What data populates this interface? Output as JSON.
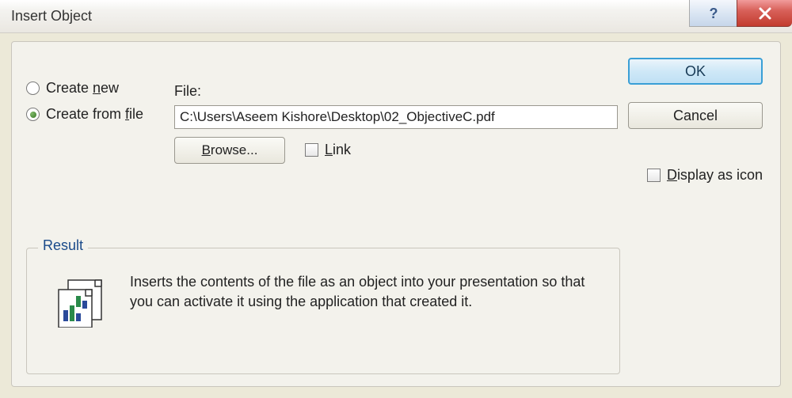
{
  "title": "Insert Object",
  "radios": {
    "create_new": "Create new",
    "create_from_file": "Create from file",
    "selected": "create_from_file"
  },
  "file_label": "File:",
  "file_path": "C:\\Users\\Aseem Kishore\\Desktop\\02_ObjectiveC.pdf",
  "browse": "Browse...",
  "link": "Link",
  "display_as_icon": "Display as icon",
  "ok": "OK",
  "cancel": "Cancel",
  "result": {
    "legend": "Result",
    "text": "Inserts the contents of the file as an object into your presentation so that you can activate it using the application that created it."
  }
}
